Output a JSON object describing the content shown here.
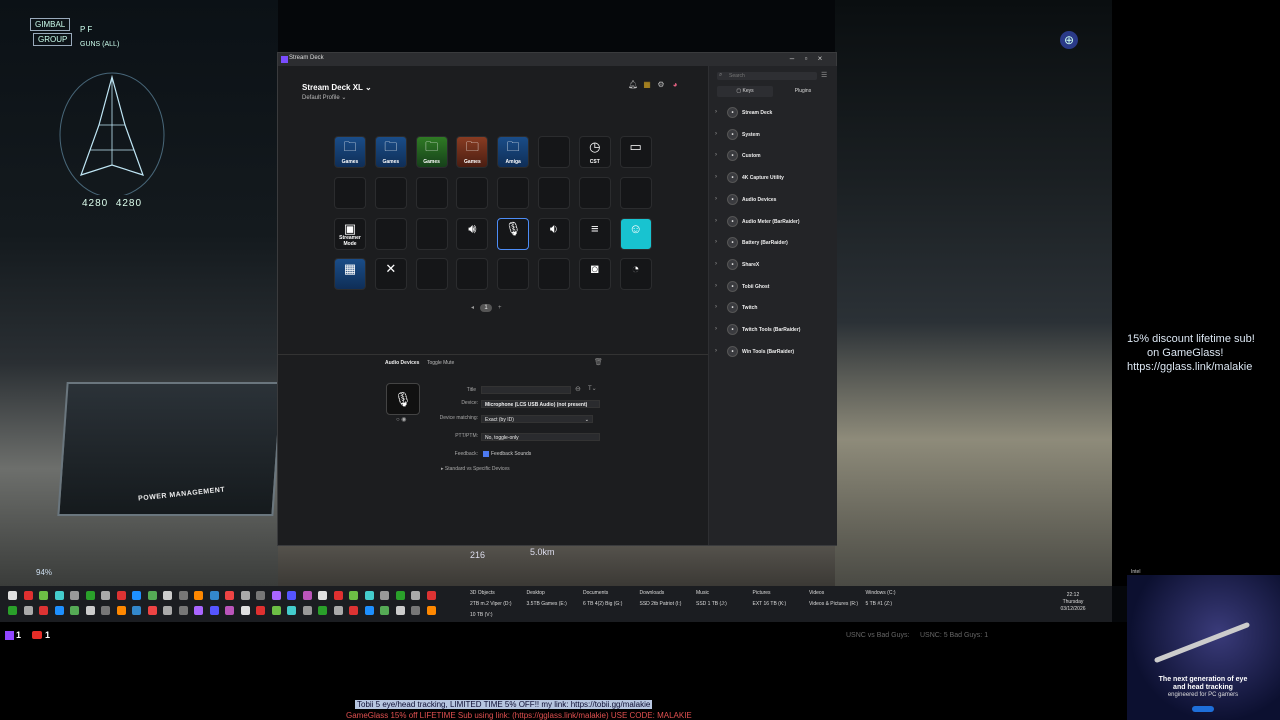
{
  "hud": {
    "gimbal": "GIMBAL",
    "group": "GROUP",
    "pf": "P F",
    "guns": "GUNS (ALL)",
    "shield_left": "4280",
    "shield_right": "4280",
    "power_label": "POWER MANAGEMENT",
    "range_1": "216",
    "range_2": "5.0km",
    "pct": "94%"
  },
  "promo": {
    "line1": "15% discount lifetime sub!",
    "line2": "on GameGlass!",
    "line3": "https://gglass.link/malakie"
  },
  "window": {
    "title": "Stream Deck",
    "device": "Stream Deck XL",
    "profile": "Default Profile",
    "page_number": "1"
  },
  "keys": [
    {
      "label": "Games",
      "icon": "folder-icon",
      "style": "blue-bg"
    },
    {
      "label": "Games",
      "icon": "folder-icon",
      "style": "blue-bg"
    },
    {
      "label": "Games",
      "icon": "folder-icon",
      "style": "green-bg"
    },
    {
      "label": "Games",
      "icon": "folder-icon",
      "style": "red-bg"
    },
    {
      "label": "Amiga",
      "icon": "folder-icon",
      "style": "blue-bg"
    },
    {
      "label": "",
      "icon": "",
      "style": ""
    },
    {
      "label": "CST",
      "icon": "clock-icon",
      "style": ""
    },
    {
      "label": "",
      "icon": "battery-icon",
      "style": ""
    },
    {
      "label": "",
      "icon": "",
      "style": ""
    },
    {
      "label": "",
      "icon": "",
      "style": ""
    },
    {
      "label": "",
      "icon": "",
      "style": ""
    },
    {
      "label": "",
      "icon": "",
      "style": ""
    },
    {
      "label": "",
      "icon": "",
      "style": ""
    },
    {
      "label": "",
      "icon": "",
      "style": ""
    },
    {
      "label": "",
      "icon": "",
      "style": ""
    },
    {
      "label": "",
      "icon": "",
      "style": ""
    },
    {
      "label": "Streamer Mode",
      "icon": "streamer-icon",
      "style": ""
    },
    {
      "label": "",
      "icon": "",
      "style": ""
    },
    {
      "label": "",
      "icon": "",
      "style": ""
    },
    {
      "label": "",
      "icon": "headset-volume-icon",
      "style": ""
    },
    {
      "label": "",
      "icon": "microphone-icon",
      "style": "selected"
    },
    {
      "label": "",
      "icon": "volume-window-icon",
      "style": ""
    },
    {
      "label": "",
      "icon": "mixer-icon",
      "style": ""
    },
    {
      "label": "",
      "icon": "cat-icon",
      "style": "cyan"
    },
    {
      "label": "",
      "icon": "app-icon",
      "style": "blue-bg"
    },
    {
      "label": "",
      "icon": "close-app-icon",
      "style": ""
    },
    {
      "label": "",
      "icon": "",
      "style": ""
    },
    {
      "label": "",
      "icon": "",
      "style": ""
    },
    {
      "label": "",
      "icon": "",
      "style": ""
    },
    {
      "label": "",
      "icon": "",
      "style": ""
    },
    {
      "label": "",
      "icon": "camera-icon",
      "style": ""
    },
    {
      "label": "",
      "icon": "ghost-icon",
      "style": ""
    }
  ],
  "inspector": {
    "breadcrumb_plugin": "Audio Devices",
    "breadcrumb_action": "Toggle Mute",
    "title_label": "Title",
    "title_value": "",
    "device_label": "Device:",
    "device_value": "Microphone (LCS USB Audio) (not present)",
    "matching_label": "Device matching:",
    "matching_value": "Exact (by ID)",
    "ptt_label": "PTT/PTM:",
    "ptt_value": "No, toggle-only",
    "feedback_label": "Feedback:",
    "feedback_value": "Feedback Sounds",
    "expand_label": "Standard vs Specific Devices"
  },
  "sidebar": {
    "search_placeholder": "Search",
    "tab_keys": "Keys",
    "tab_plugins": "Plugins",
    "categories": [
      {
        "name": "Stream Deck",
        "icon": "streamdeck-icon"
      },
      {
        "name": "System",
        "icon": "system-icon"
      },
      {
        "name": "Custom",
        "icon": "custom-icon"
      },
      {
        "name": "4K Capture Utility",
        "icon": "capture-icon"
      },
      {
        "name": "Audio Devices",
        "icon": "audio-devices-icon"
      },
      {
        "name": "Audio Meter (BarRaider)",
        "icon": "audio-meter-icon"
      },
      {
        "name": "Battery (BarRaider)",
        "icon": "battery-icon"
      },
      {
        "name": "ShareX",
        "icon": "sharex-icon"
      },
      {
        "name": "Tobii Ghost",
        "icon": "tobii-icon"
      },
      {
        "name": "Twitch",
        "icon": "twitch-icon"
      },
      {
        "name": "Twitch Tools (BarRaider)",
        "icon": "twitch-tools-icon"
      },
      {
        "name": "Win Tools (BarRaider)",
        "icon": "win-tools-icon"
      }
    ]
  },
  "taskbar": {
    "drives_row1": [
      "3D Objects",
      "Desktop",
      "Documents",
      "Downloads",
      "Music",
      "Pictures",
      "Videos",
      "Windows (C:)"
    ],
    "drives_row2": [
      "2TB m.2 Viper (D:)",
      "3.5TB Games (E:)",
      "6 TB 4(2) Big (G:)",
      "SSD 2tb Patriot (I:)",
      "SSD 1 TB (J:)",
      "EXT 16 TB (K:)",
      "Videos & Pictures (R:)",
      "5 TB #1 (Z:)"
    ],
    "drives_row3": "10 TB (V:)",
    "time": "22:12",
    "day": "Thursday",
    "date": "03/12/2026"
  },
  "stream": {
    "twitch_count": "1",
    "youtube_count": "1",
    "score_left": "USNC vs Bad Guys:",
    "score_right": "USNC: 5   Bad Guys: 1",
    "ticker1": "Tobii 5 eye/head tracking, LIMITED TIME 5% OFF!!  my link:  https://tobii.gg/malakie",
    "ticker2": "GameGlass 15% off LIFETIME Sub using link: (https://gglass.link/malakie)  USE CODE:  MALAKIE",
    "ad_top": "Intel",
    "ad_title": "The next generation of eye and head tracking",
    "ad_sub": "engineered for PC gamers"
  }
}
